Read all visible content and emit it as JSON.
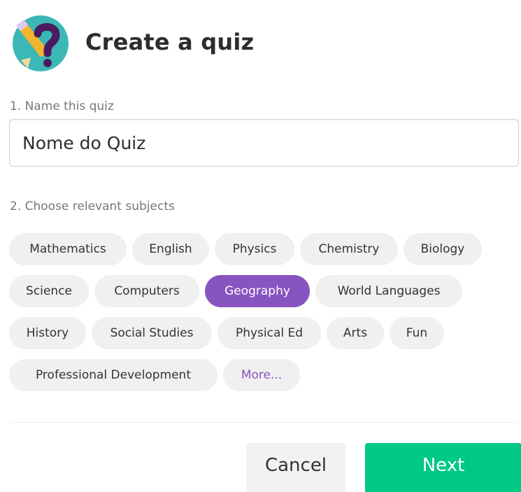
{
  "header": {
    "title": "Create a quiz",
    "logo_icon": "pencil-question-mark-icon"
  },
  "name_section": {
    "label": "1. Name this quiz",
    "value": "Nome do Quiz"
  },
  "subjects_section": {
    "label": "2. Choose relevant subjects",
    "rows": [
      [
        {
          "label": "Mathematics",
          "selected": false
        },
        {
          "label": "English",
          "selected": false
        },
        {
          "label": "Physics",
          "selected": false
        },
        {
          "label": "Chemistry",
          "selected": false
        },
        {
          "label": "Biology",
          "selected": false
        }
      ],
      [
        {
          "label": "Science",
          "selected": false
        },
        {
          "label": "Computers",
          "selected": false
        },
        {
          "label": "Geography",
          "selected": true
        },
        {
          "label": "World Languages",
          "selected": false
        }
      ],
      [
        {
          "label": "History",
          "selected": false
        },
        {
          "label": "Social Studies",
          "selected": false
        },
        {
          "label": "Physical Ed",
          "selected": false
        },
        {
          "label": "Arts",
          "selected": false
        },
        {
          "label": "Fun",
          "selected": false
        }
      ],
      [
        {
          "label": "Professional Development",
          "selected": false
        },
        {
          "label": "More...",
          "selected": false,
          "more": true
        }
      ]
    ]
  },
  "footer": {
    "cancel_label": "Cancel",
    "next_label": "Next"
  },
  "colors": {
    "accent": "#8854c0",
    "primary_button": "#00c985",
    "logo_circle": "#3bb8b6"
  }
}
